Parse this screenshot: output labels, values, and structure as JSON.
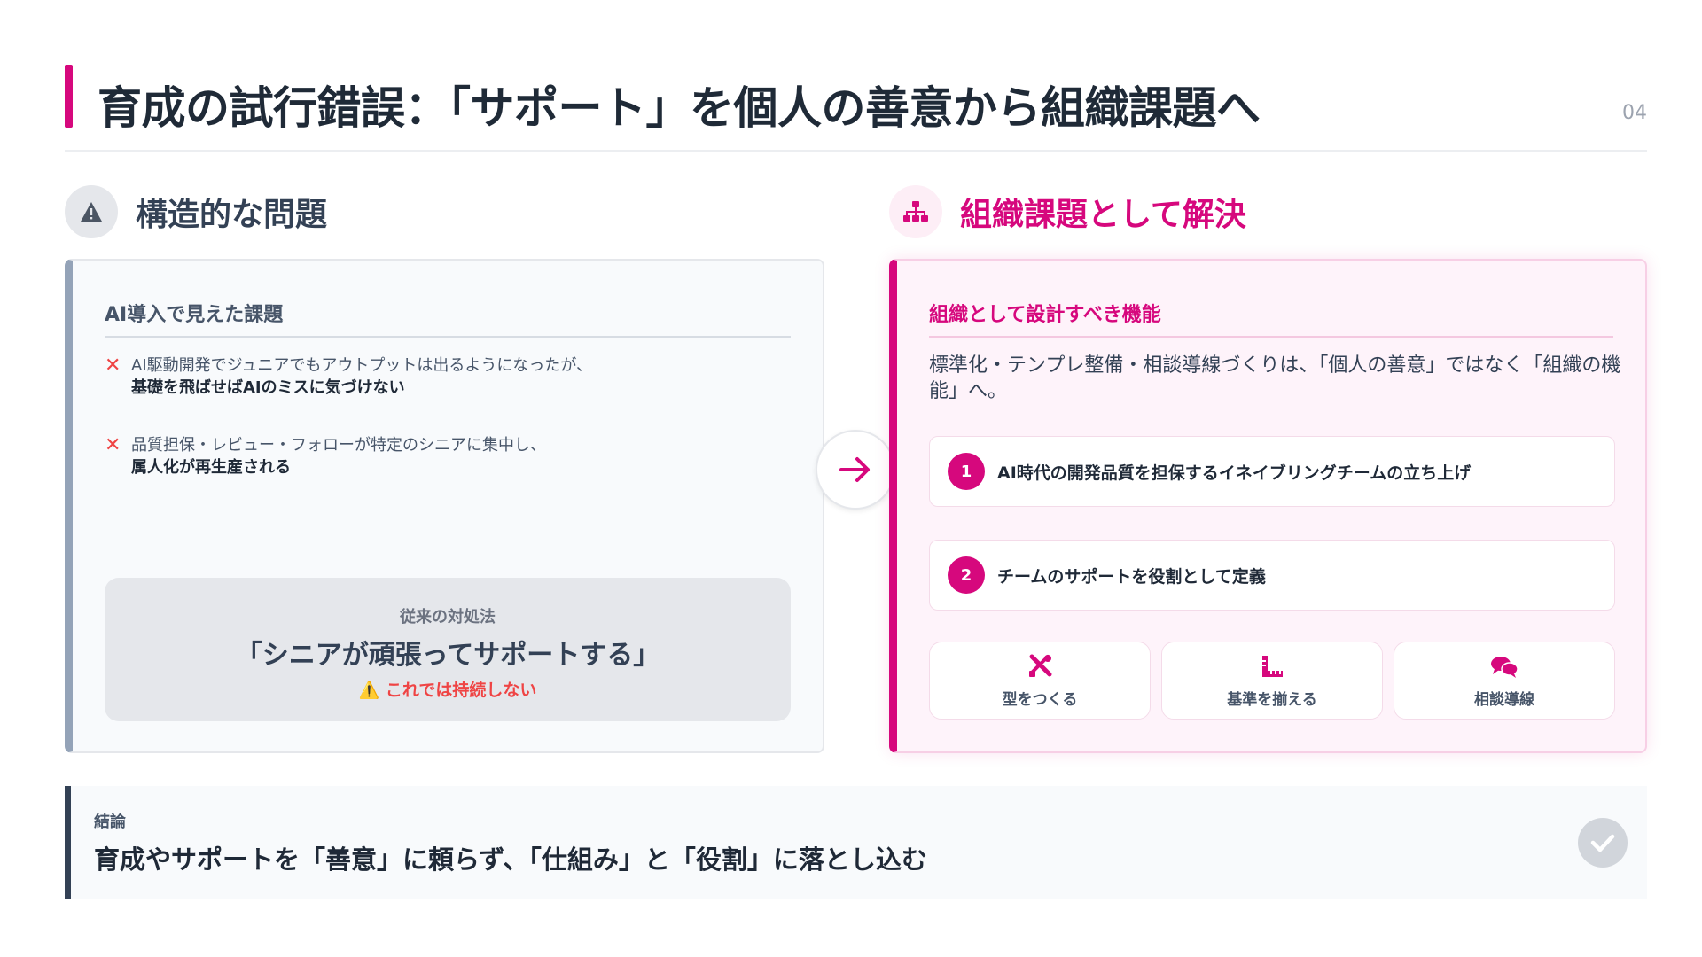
{
  "header": {
    "title": "育成の試行錯誤：「サポート」を個人の善意から組織課題へ",
    "page_number": "04"
  },
  "left_section": {
    "icon": "warning-icon",
    "title": "構造的な問題",
    "card_heading": "AI導入で見えた課題",
    "issues": [
      {
        "text": "AI駆動開発でジュニアでもアウトプットは出るようになったが、",
        "bold": "基礎を飛ばせばAIのミスに気づけない"
      },
      {
        "text": "品質担保・レビュー・フォローが特定のシニアに集中し、",
        "bold": "属人化が再生産される"
      }
    ],
    "old_approach": {
      "label": "従来の対処法",
      "quote": "「シニアが頑張ってサポートする」",
      "warning": "⚠️ これでは持続しない"
    }
  },
  "right_section": {
    "icon": "org-chart-icon",
    "title": "組織課題として解決",
    "card_heading": "組織として設計すべき機能",
    "lead": "標準化・テンプレ整備・相談導線づくりは、「個人の善意」ではなく「組織の機能」へ。",
    "steps": [
      {
        "num": "1",
        "label": "AI時代の開発品質を担保するイネイブリングチームの立ち上げ"
      },
      {
        "num": "2",
        "label": "チームのサポートを役割として定義"
      }
    ],
    "chips": [
      {
        "icon": "tools-icon",
        "label": "型をつくる"
      },
      {
        "icon": "ruler-icon",
        "label": "基準を揃える"
      },
      {
        "icon": "chat-icon",
        "label": "相談導線"
      }
    ]
  },
  "conclusion": {
    "label": "結論",
    "text": "育成やサポートを「善意」に頼らず、「仕組み」と「役割」に落とし込む"
  },
  "colors": {
    "accent": "#d6087d",
    "dark": "#1f2937",
    "slate": "#94a3b8",
    "danger": "#ef4444"
  }
}
